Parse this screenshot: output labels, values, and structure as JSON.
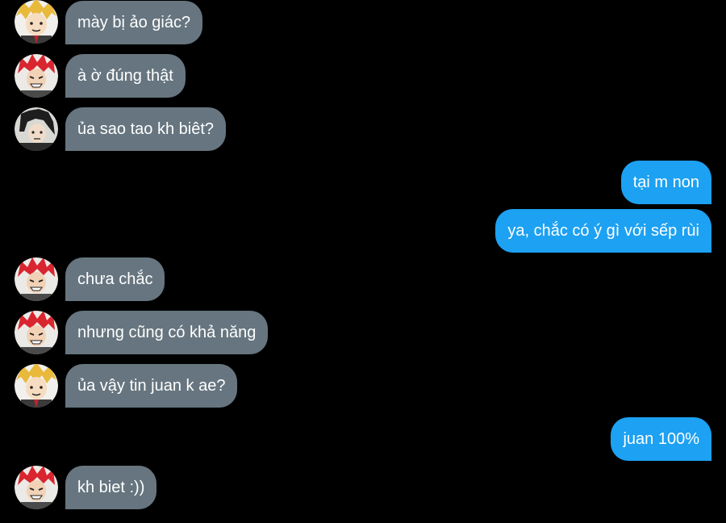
{
  "messages": [
    {
      "direction": "in",
      "sender_avatar": "yellow-hair-avatar",
      "text": "mày bị ảo giác?"
    },
    {
      "direction": "in",
      "sender_avatar": "red-hair-avatar",
      "text": "à ờ đúng thật"
    },
    {
      "direction": "in",
      "sender_avatar": "dark-hair-avatar",
      "text": "ủa sao tao kh biêt?"
    },
    {
      "direction": "out",
      "text": "tại m non"
    },
    {
      "direction": "out",
      "text": "ya, chắc có ý gì với sếp rùi"
    },
    {
      "direction": "in",
      "sender_avatar": "red-hair-avatar",
      "text": "chưa chắc"
    },
    {
      "direction": "in",
      "sender_avatar": "red-hair-avatar",
      "text": "nhưng cũng có khả năng"
    },
    {
      "direction": "in",
      "sender_avatar": "yellow-hair-avatar",
      "text": "ủa vậy tin juan k ae?"
    },
    {
      "direction": "out",
      "text": "juan 100%"
    },
    {
      "direction": "in",
      "sender_avatar": "red-hair-avatar",
      "text": "kh biet :))"
    }
  ],
  "colors": {
    "background": "#000000",
    "incoming_bubble": "#66757f",
    "outgoing_bubble": "#1da1f2",
    "text": "#ffffff"
  }
}
